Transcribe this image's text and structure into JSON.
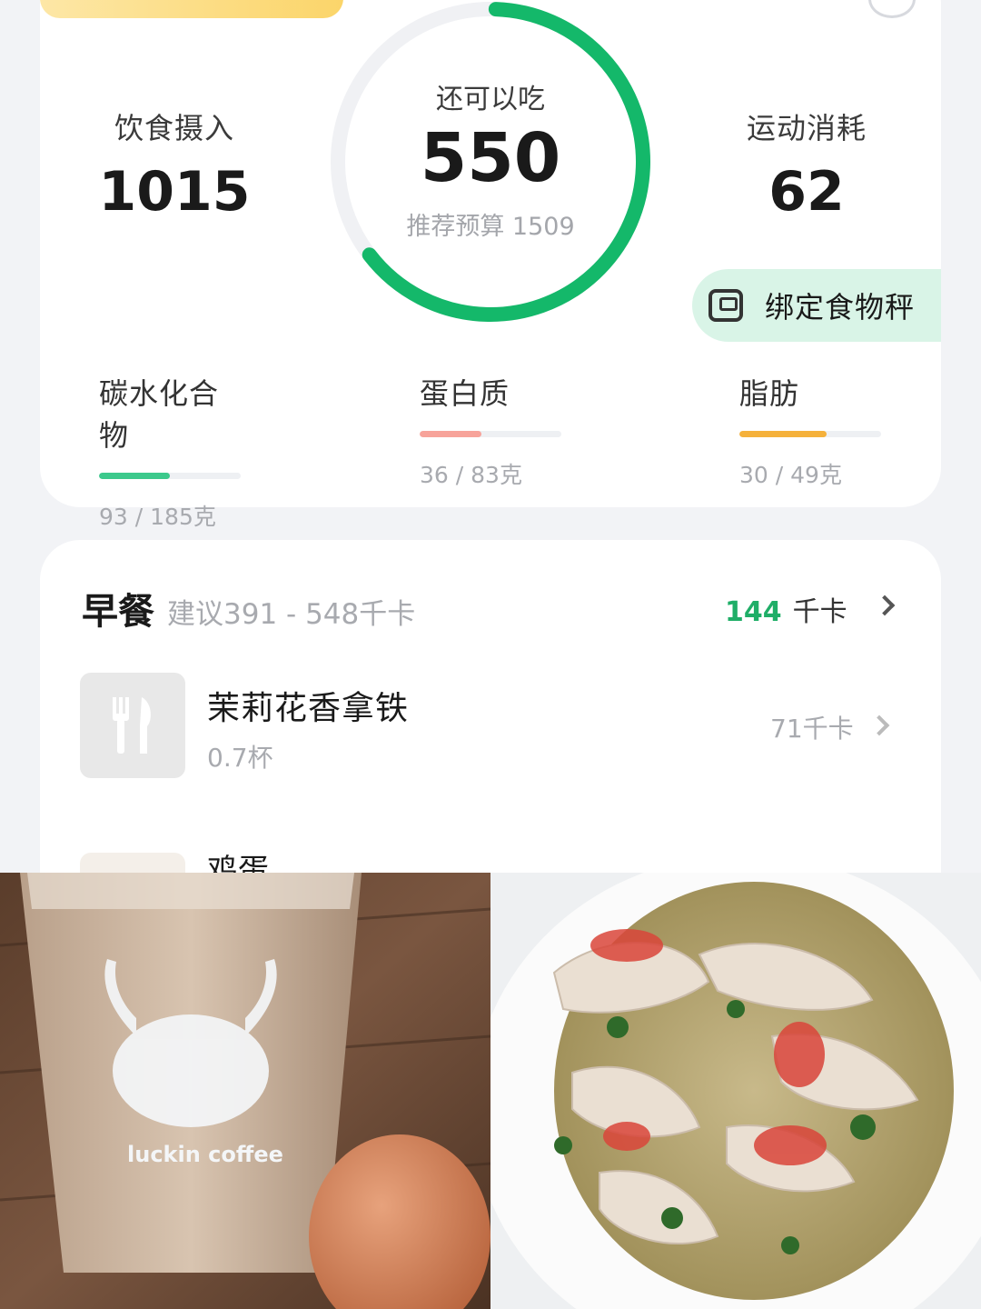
{
  "summary": {
    "intake": {
      "label": "饮食摄入",
      "value": "1015"
    },
    "remaining": {
      "label": "还可以吃",
      "value": "550",
      "budget": "推荐预算 1509",
      "progress": 0.64
    },
    "burn": {
      "label": "运动消耗",
      "value": "62"
    },
    "bind_scale": {
      "label": "绑定食物秤",
      "icon": "scale-icon"
    }
  },
  "macros": [
    {
      "name": "碳水化合物",
      "amount": "93 / 185克",
      "current": 93,
      "target": 185,
      "color": "#3cc98c"
    },
    {
      "name": "蛋白质",
      "amount": "36 / 83克",
      "current": 36,
      "target": 83,
      "color": "#f7a39a"
    },
    {
      "name": "脂肪",
      "amount": "30 / 49克",
      "current": 30,
      "target": 49,
      "color": "#f5b13b"
    }
  ],
  "meal": {
    "title": "早餐",
    "suggest": "建议391 - 548千卡",
    "kcal": "144",
    "kcal_unit": "千卡",
    "items": [
      {
        "name": "茉莉花香拿铁",
        "qty": "0.7杯",
        "kcal": "71千卡",
        "icon": "fork-knife-icon"
      },
      {
        "name": "鸡蛋"
      }
    ]
  },
  "photos": {
    "coffee_cup_text": "luckin coffee"
  },
  "colors": {
    "accent_green": "#1fae67",
    "ring_green": "#14b86a",
    "ring_track": "#f0f1f4"
  }
}
